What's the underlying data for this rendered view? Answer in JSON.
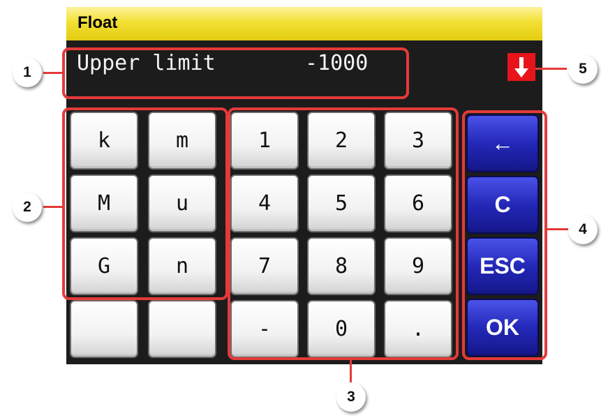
{
  "title_bar": {
    "title": "Float"
  },
  "input_display": {
    "label": "Upper limit",
    "value": "-1000"
  },
  "direction_indicator": {
    "icon": "arrow-down-icon",
    "color": "#e8141b"
  },
  "unit_keys": [
    "k",
    "m",
    "M",
    "u",
    "G",
    "n",
    "",
    ""
  ],
  "numeric_keys": [
    "1",
    "2",
    "3",
    "4",
    "5",
    "6",
    "7",
    "8",
    "9",
    "-",
    "0",
    "."
  ],
  "control_keys": [
    "←",
    "C",
    "ESC",
    "OK"
  ],
  "callouts": [
    "1",
    "2",
    "3",
    "4",
    "5"
  ],
  "colors": {
    "title_bar": "#f2e033",
    "screen_background": "#1c1c1c",
    "control_key": "#2328b8",
    "callout_outline": "#e43a3a"
  }
}
